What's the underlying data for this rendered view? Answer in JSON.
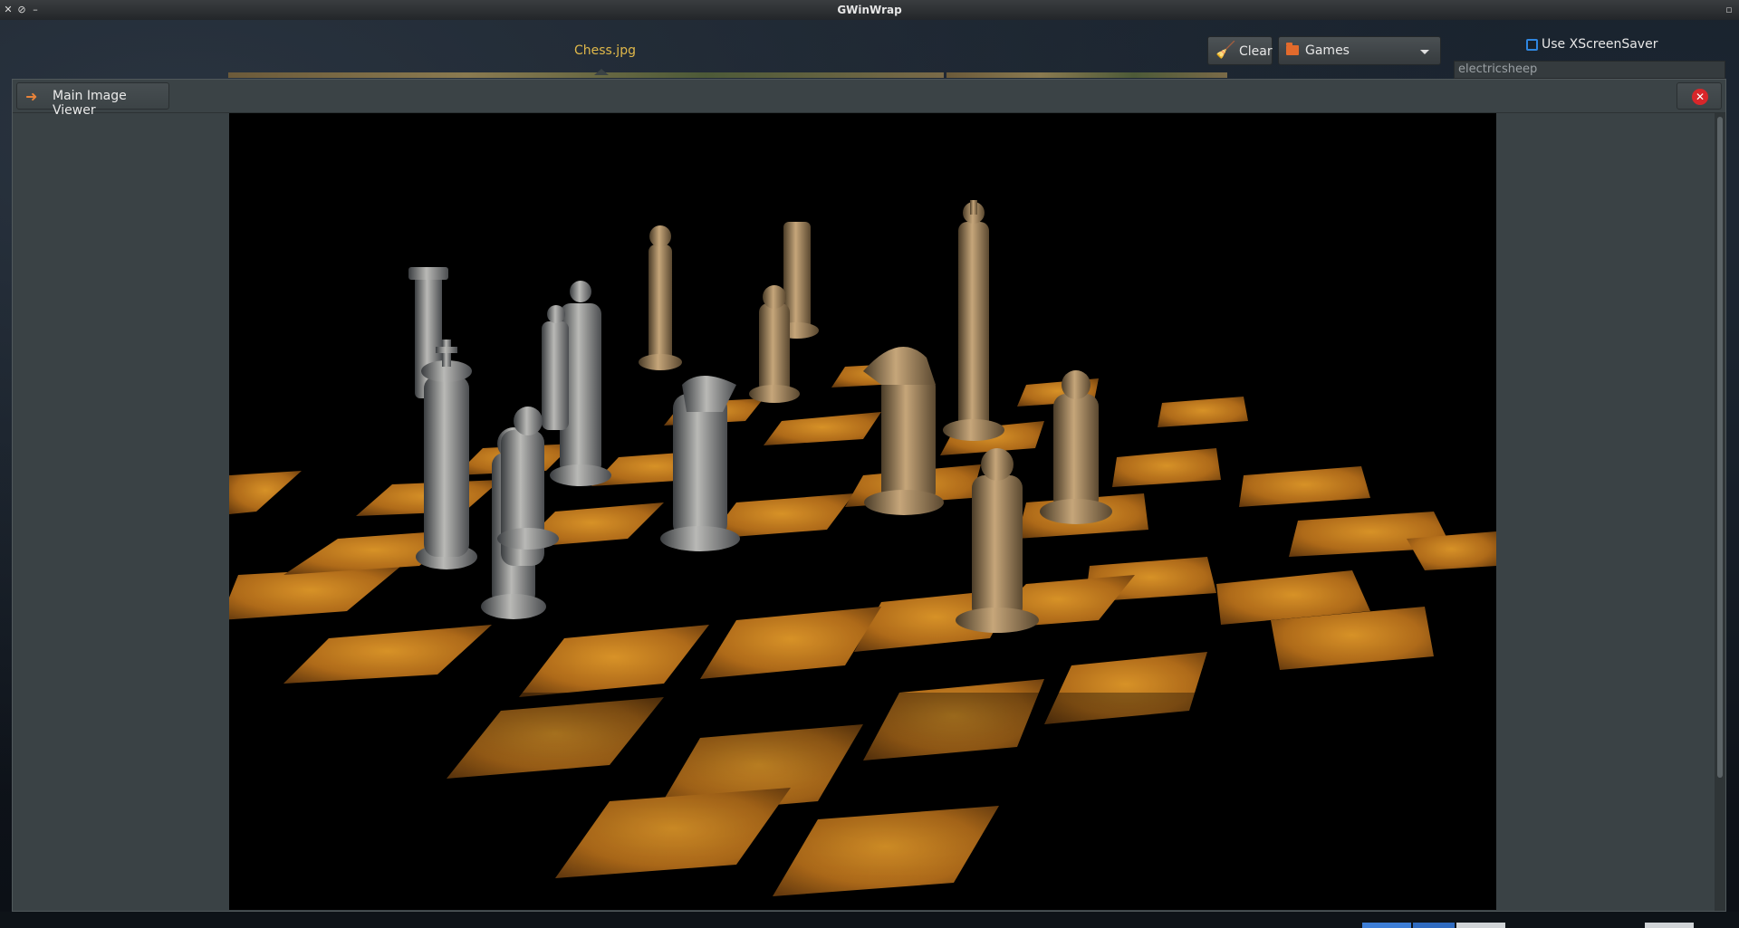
{
  "window": {
    "title": "GWinWrap"
  },
  "top": {
    "current_file": "Chess.jpg",
    "clear_label": "Clear",
    "category_selected": "Games",
    "use_xscreensaver_label": "Use XScreenSaver",
    "use_xscreensaver_checked": false,
    "screensaver_value": "electricsheep"
  },
  "viewer": {
    "tab_label": "Main Image Viewer",
    "close_icon": "close-icon",
    "image_alt": "chess board with pieces"
  },
  "icons": {
    "window_close": "close-icon",
    "window_restore": "restore-icon",
    "window_minimize": "minimize-icon",
    "clear": "broom-icon",
    "category": "folder-icon",
    "viewer": "viewer-app-icon"
  },
  "colors": {
    "accent_filename": "#e0b84a",
    "checkbox": "#2f86e0",
    "close_red": "#d8262a",
    "board_orange": "#c9801f"
  }
}
